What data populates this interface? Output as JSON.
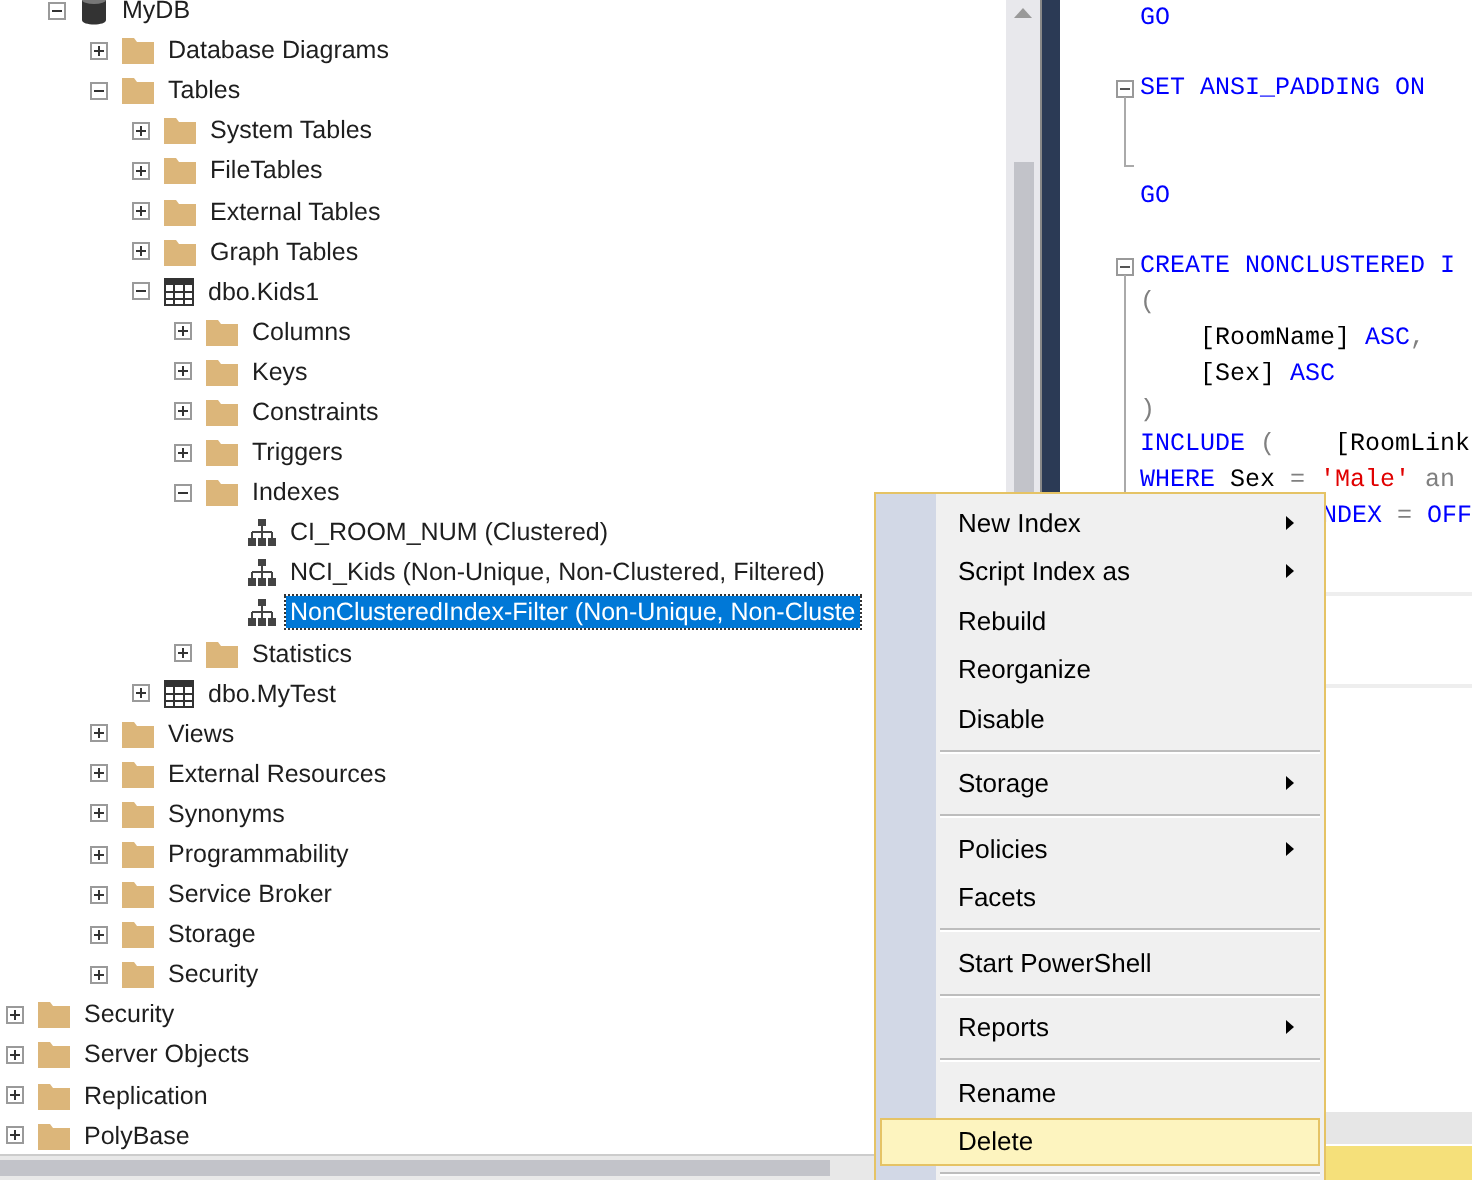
{
  "tree": {
    "items": [
      {
        "children": [
          {
            "label": "MyDB",
            "kind": "database",
            "expanded": true,
            "selected": false,
            "children": [
              {
                "label": "Database Diagrams",
                "kind": "folder",
                "expanded": false,
                "selected": false
              },
              {
                "label": "Tables",
                "kind": "folder",
                "expanded": true,
                "selected": false,
                "children": [
                  {
                    "label": "System Tables",
                    "kind": "folder",
                    "expanded": false,
                    "selected": false
                  },
                  {
                    "label": "FileTables",
                    "kind": "folder",
                    "expanded": false,
                    "selected": false
                  },
                  {
                    "label": "External Tables",
                    "kind": "folder",
                    "expanded": false,
                    "selected": false
                  },
                  {
                    "label": "Graph Tables",
                    "kind": "folder",
                    "expanded": false,
                    "selected": false
                  },
                  {
                    "label": "dbo.Kids1",
                    "kind": "table",
                    "expanded": true,
                    "selected": false,
                    "children": [
                      {
                        "label": "Columns",
                        "kind": "folder",
                        "expanded": false,
                        "selected": false
                      },
                      {
                        "label": "Keys",
                        "kind": "folder",
                        "expanded": false,
                        "selected": false
                      },
                      {
                        "label": "Constraints",
                        "kind": "folder",
                        "expanded": false,
                        "selected": false
                      },
                      {
                        "label": "Triggers",
                        "kind": "folder",
                        "expanded": false,
                        "selected": false
                      },
                      {
                        "label": "Indexes",
                        "kind": "folder",
                        "expanded": true,
                        "selected": false,
                        "children": [
                          {
                            "label": "CI_ROOM_NUM (Clustered)",
                            "kind": "index",
                            "selected": false
                          },
                          {
                            "label": "NCI_Kids (Non-Unique, Non-Clustered, Filtered)",
                            "kind": "index",
                            "selected": false
                          },
                          {
                            "label": "NonClusteredIndex-Filter (Non-Unique, Non-Cluste",
                            "kind": "index",
                            "selected": true
                          }
                        ]
                      },
                      {
                        "label": "Statistics",
                        "kind": "folder",
                        "expanded": false,
                        "selected": false
                      }
                    ]
                  },
                  {
                    "label": "dbo.MyTest",
                    "kind": "table",
                    "expanded": false,
                    "selected": false
                  }
                ]
              },
              {
                "label": "Views",
                "kind": "folder",
                "expanded": false,
                "selected": false
              },
              {
                "label": "External Resources",
                "kind": "folder",
                "expanded": false,
                "selected": false
              },
              {
                "label": "Synonyms",
                "kind": "folder",
                "expanded": false,
                "selected": false
              },
              {
                "label": "Programmability",
                "kind": "folder",
                "expanded": false,
                "selected": false
              },
              {
                "label": "Service Broker",
                "kind": "folder",
                "expanded": false,
                "selected": false
              },
              {
                "label": "Storage",
                "kind": "folder",
                "expanded": false,
                "selected": false
              },
              {
                "label": "Security",
                "kind": "folder",
                "expanded": false,
                "selected": false
              }
            ]
          }
        ]
      },
      {
        "label": "Security",
        "kind": "folder",
        "expanded": false,
        "selected": false
      },
      {
        "label": "Server Objects",
        "kind": "folder",
        "expanded": false,
        "selected": false
      },
      {
        "label": "Replication",
        "kind": "folder",
        "expanded": false,
        "selected": false
      },
      {
        "label": "PolyBase",
        "kind": "folder",
        "expanded": false,
        "selected": false
      }
    ]
  },
  "editor": {
    "blocks": [
      {
        "lines": [
          {
            "kind": "code",
            "tokens": [
              {
                "text": "GO",
                "kind": "keyword"
              }
            ]
          },
          {
            "kind": "blank"
          }
        ]
      },
      {
        "expanded": true,
        "lines": [
          {
            "kind": "code",
            "tokens": [
              {
                "text": "SET ANSI_PADDING ON",
                "kind": "keyword"
              }
            ]
          },
          {
            "kind": "blank"
          },
          {
            "kind": "blank"
          }
        ]
      },
      {
        "lines": [
          {
            "kind": "code",
            "tokens": [
              {
                "text": "GO",
                "kind": "keyword"
              }
            ]
          },
          {
            "kind": "blank"
          }
        ]
      },
      {
        "expanded": true,
        "lines": [
          {
            "kind": "code",
            "tokens": [
              {
                "text": "CREATE NONCLUSTERED I",
                "kind": "keyword"
              }
            ]
          },
          {
            "kind": "code",
            "tokens": [
              {
                "text": "(",
                "kind": "operator"
              }
            ]
          },
          {
            "kind": "indented",
            "tokens": [
              {
                "text": "[RoomName] ",
                "kind": "plain"
              },
              {
                "text": "ASC",
                "kind": "keyword"
              },
              {
                "text": ",",
                "kind": "operator"
              }
            ]
          },
          {
            "kind": "indented",
            "tokens": [
              {
                "text": "[Sex] ",
                "kind": "plain"
              },
              {
                "text": "ASC",
                "kind": "keyword"
              }
            ]
          },
          {
            "kind": "code",
            "tokens": [
              {
                "text": ")",
                "kind": "operator"
              }
            ]
          },
          {
            "kind": "code",
            "tokens": [
              {
                "text": "INCLUDE ",
                "kind": "keyword"
              },
              {
                "text": "(    ",
                "kind": "operator"
              },
              {
                "text": "[RoomLink",
                "kind": "plain"
              }
            ]
          },
          {
            "kind": "code",
            "tokens": [
              {
                "text": "WHERE ",
                "kind": "keyword"
              },
              {
                "text": "Sex ",
                "kind": "plain"
              },
              {
                "text": "= ",
                "kind": "operator"
              },
              {
                "text": "'Male' ",
                "kind": "string"
              },
              {
                "text": "an",
                "kind": "operator"
              }
            ]
          },
          {
            "kind": "partial",
            "tokens": [
              {
                "text": "NDEX ",
                "kind": "keyword"
              },
              {
                "text": "= ",
                "kind": "operator"
              },
              {
                "text": "OFF",
                "kind": "keyword"
              }
            ]
          }
        ]
      }
    ]
  },
  "context_menu": {
    "items": [
      {
        "kind": "item",
        "label": "New Index",
        "has_submenu": true,
        "selected": false
      },
      {
        "kind": "item",
        "label": "Script Index as",
        "has_submenu": true,
        "selected": false
      },
      {
        "kind": "item",
        "label": "Rebuild",
        "has_submenu": false,
        "selected": false
      },
      {
        "kind": "item",
        "label": "Reorganize",
        "has_submenu": false,
        "selected": false
      },
      {
        "kind": "item",
        "label": "Disable",
        "has_submenu": false,
        "selected": false
      },
      {
        "kind": "separator"
      },
      {
        "kind": "item",
        "label": "Storage",
        "has_submenu": true,
        "selected": false
      },
      {
        "kind": "separator"
      },
      {
        "kind": "item",
        "label": "Policies",
        "has_submenu": true,
        "selected": false
      },
      {
        "kind": "item",
        "label": "Facets",
        "has_submenu": false,
        "selected": false
      },
      {
        "kind": "separator"
      },
      {
        "kind": "item",
        "label": "Start PowerShell",
        "has_submenu": false,
        "selected": false
      },
      {
        "kind": "separator"
      },
      {
        "kind": "item",
        "label": "Reports",
        "has_submenu": true,
        "selected": false
      },
      {
        "kind": "separator"
      },
      {
        "kind": "item",
        "label": "Rename",
        "has_submenu": false,
        "selected": false
      },
      {
        "kind": "item",
        "label": "Delete",
        "has_submenu": false,
        "selected": true
      },
      {
        "kind": "separator"
      }
    ]
  }
}
